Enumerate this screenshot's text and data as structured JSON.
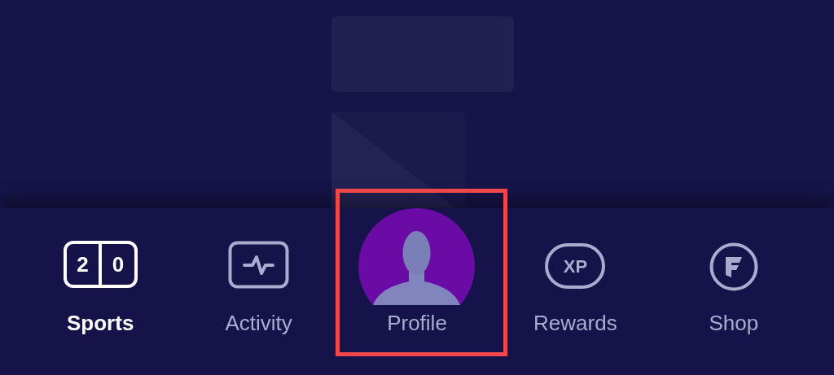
{
  "nav": {
    "items": [
      {
        "kind": "score",
        "label": "Sports",
        "selected": true,
        "highlighted": false,
        "icon_text": [
          "2",
          "0"
        ]
      },
      {
        "kind": "pulse",
        "label": "Activity",
        "selected": false,
        "highlighted": false
      },
      {
        "kind": "avatar",
        "label": "Profile",
        "selected": false,
        "highlighted": true
      },
      {
        "kind": "xp",
        "label": "Rewards",
        "selected": false,
        "highlighted": false,
        "icon_text": [
          "XP"
        ]
      },
      {
        "kind": "coin",
        "label": "Shop",
        "selected": false,
        "highlighted": false
      }
    ]
  }
}
